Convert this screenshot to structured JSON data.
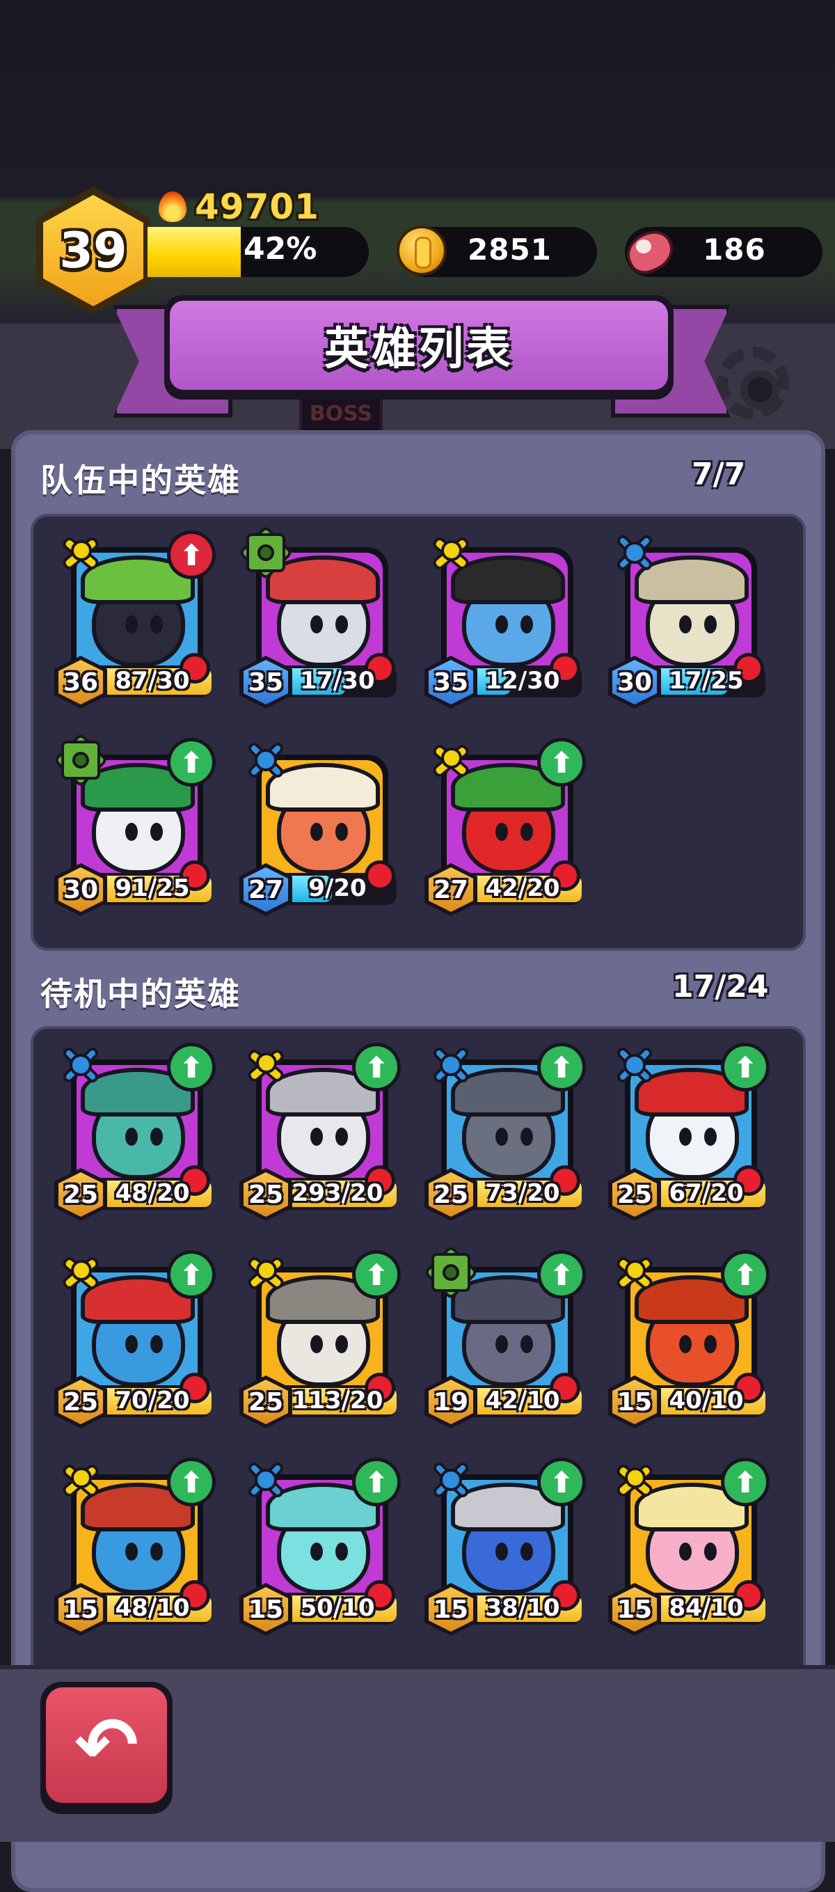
{
  "header": {
    "player_level": "39",
    "power": "49701",
    "xp_percent": "42%",
    "xp_fraction": 0.42,
    "gold": "2851",
    "meat": "186"
  },
  "title": "英雄列表",
  "map_tag": "BOSS",
  "team_section": {
    "label": "队伍中的英雄",
    "count": "7/7"
  },
  "standby_section": {
    "label": "待机中的英雄",
    "count": "17/24"
  },
  "team_heroes": [
    {
      "level": "36",
      "progress": "87/30",
      "level_color": "gold",
      "class": "gold",
      "bg": "blue",
      "upgrade": "red",
      "fill": 1.0,
      "body": "#2a2a3a",
      "hat": "#6cc040"
    },
    {
      "level": "35",
      "progress": "17/30",
      "level_color": "blue",
      "class": "green",
      "bg": "purple",
      "upgrade": "none",
      "fill": 0.57,
      "body": "#d8dde8",
      "hat": "#d84040"
    },
    {
      "level": "35",
      "progress": "12/30",
      "level_color": "blue",
      "class": "gold",
      "bg": "purple",
      "upgrade": "none",
      "fill": 0.4,
      "body": "#5aa8e8",
      "hat": "#2a2a2a"
    },
    {
      "level": "30",
      "progress": "17/25",
      "level_color": "blue",
      "class": "blue",
      "bg": "purple",
      "upgrade": "none",
      "fill": 0.68,
      "body": "#e8e2c8",
      "hat": "#c8c0a0"
    },
    {
      "level": "30",
      "progress": "91/25",
      "level_color": "gold",
      "class": "green",
      "bg": "purple",
      "upgrade": "green",
      "fill": 1.0,
      "body": "#eef0f4",
      "hat": "#2a9a4a"
    },
    {
      "level": "27",
      "progress": "9/20",
      "level_color": "blue",
      "class": "blue",
      "bg": "gold",
      "upgrade": "none",
      "fill": 0.45,
      "body": "#f07850",
      "hat": "#f4ecd8"
    },
    {
      "level": "27",
      "progress": "42/20",
      "level_color": "gold",
      "class": "gold",
      "bg": "purple",
      "upgrade": "green",
      "fill": 1.0,
      "body": "#e02828",
      "hat": "#3aa03a"
    }
  ],
  "standby_heroes": [
    {
      "level": "25",
      "progress": "48/20",
      "level_color": "gold",
      "class": "blue",
      "bg": "purple",
      "upgrade": "green",
      "fill": 1.0,
      "body": "#4ab8a8",
      "hat": "#3a9a8a"
    },
    {
      "level": "25",
      "progress": "293/20",
      "level_color": "gold",
      "class": "gold",
      "bg": "purple",
      "upgrade": "green",
      "fill": 1.0,
      "body": "#e8e8ec",
      "hat": "#b8b8c0"
    },
    {
      "level": "25",
      "progress": "73/20",
      "level_color": "gold",
      "class": "blue",
      "bg": "blue",
      "upgrade": "green",
      "fill": 1.0,
      "body": "#6a7080",
      "hat": "#5a6070"
    },
    {
      "level": "25",
      "progress": "67/20",
      "level_color": "gold",
      "class": "blue",
      "bg": "blue",
      "upgrade": "green",
      "fill": 1.0,
      "body": "#f0f4f8",
      "hat": "#d82a2a"
    },
    {
      "level": "25",
      "progress": "70/20",
      "level_color": "gold",
      "class": "gold",
      "bg": "blue",
      "upgrade": "green",
      "fill": 1.0,
      "body": "#3a9ae0",
      "hat": "#d83030"
    },
    {
      "level": "25",
      "progress": "113/20",
      "level_color": "gold",
      "class": "gold",
      "bg": "gold",
      "upgrade": "green",
      "fill": 1.0,
      "body": "#eae6e0",
      "hat": "#8a8680"
    },
    {
      "level": "19",
      "progress": "42/10",
      "level_color": "gold",
      "class": "green",
      "bg": "blue",
      "upgrade": "green",
      "fill": 1.0,
      "body": "#6a6a84",
      "hat": "#4a4a60"
    },
    {
      "level": "15",
      "progress": "40/10",
      "level_color": "gold",
      "class": "gold",
      "bg": "gold",
      "upgrade": "green",
      "fill": 1.0,
      "body": "#e8502a",
      "hat": "#c83a1a"
    },
    {
      "level": "15",
      "progress": "48/10",
      "level_color": "gold",
      "class": "gold",
      "bg": "gold",
      "upgrade": "green",
      "fill": 1.0,
      "body": "#3a9ae0",
      "hat": "#c83a2a"
    },
    {
      "level": "15",
      "progress": "50/10",
      "level_color": "gold",
      "class": "blue",
      "bg": "purple",
      "upgrade": "green",
      "fill": 1.0,
      "body": "#7ae0e0",
      "hat": "#6ad0d0"
    },
    {
      "level": "15",
      "progress": "38/10",
      "level_color": "gold",
      "class": "blue",
      "bg": "blue",
      "upgrade": "green",
      "fill": 1.0,
      "body": "#3a6ad8",
      "hat": "#c8c8d0"
    },
    {
      "level": "15",
      "progress": "84/10",
      "level_color": "gold",
      "class": "gold",
      "bg": "gold",
      "upgrade": "green",
      "fill": 1.0,
      "body": "#f8b0c8",
      "hat": "#f4e6a0"
    }
  ],
  "icons": {
    "power": "flame-icon",
    "gold": "coin-icon",
    "meat": "meat-icon",
    "settings": "gear-icon",
    "back": "back-arrow-icon",
    "upgrade": "up-arrow-icon",
    "notification": "red-dot-icon"
  },
  "glyphs": {
    "up_arrow": "⬆",
    "alert_arrow": "⬆",
    "back_arrow": "↶"
  },
  "colors": {
    "panel": "#6c6b90",
    "ribbon": "#b155c8",
    "xp": "#ffd400",
    "upgrade_green": "#2fb85a",
    "alert_red": "#e0263a"
  }
}
